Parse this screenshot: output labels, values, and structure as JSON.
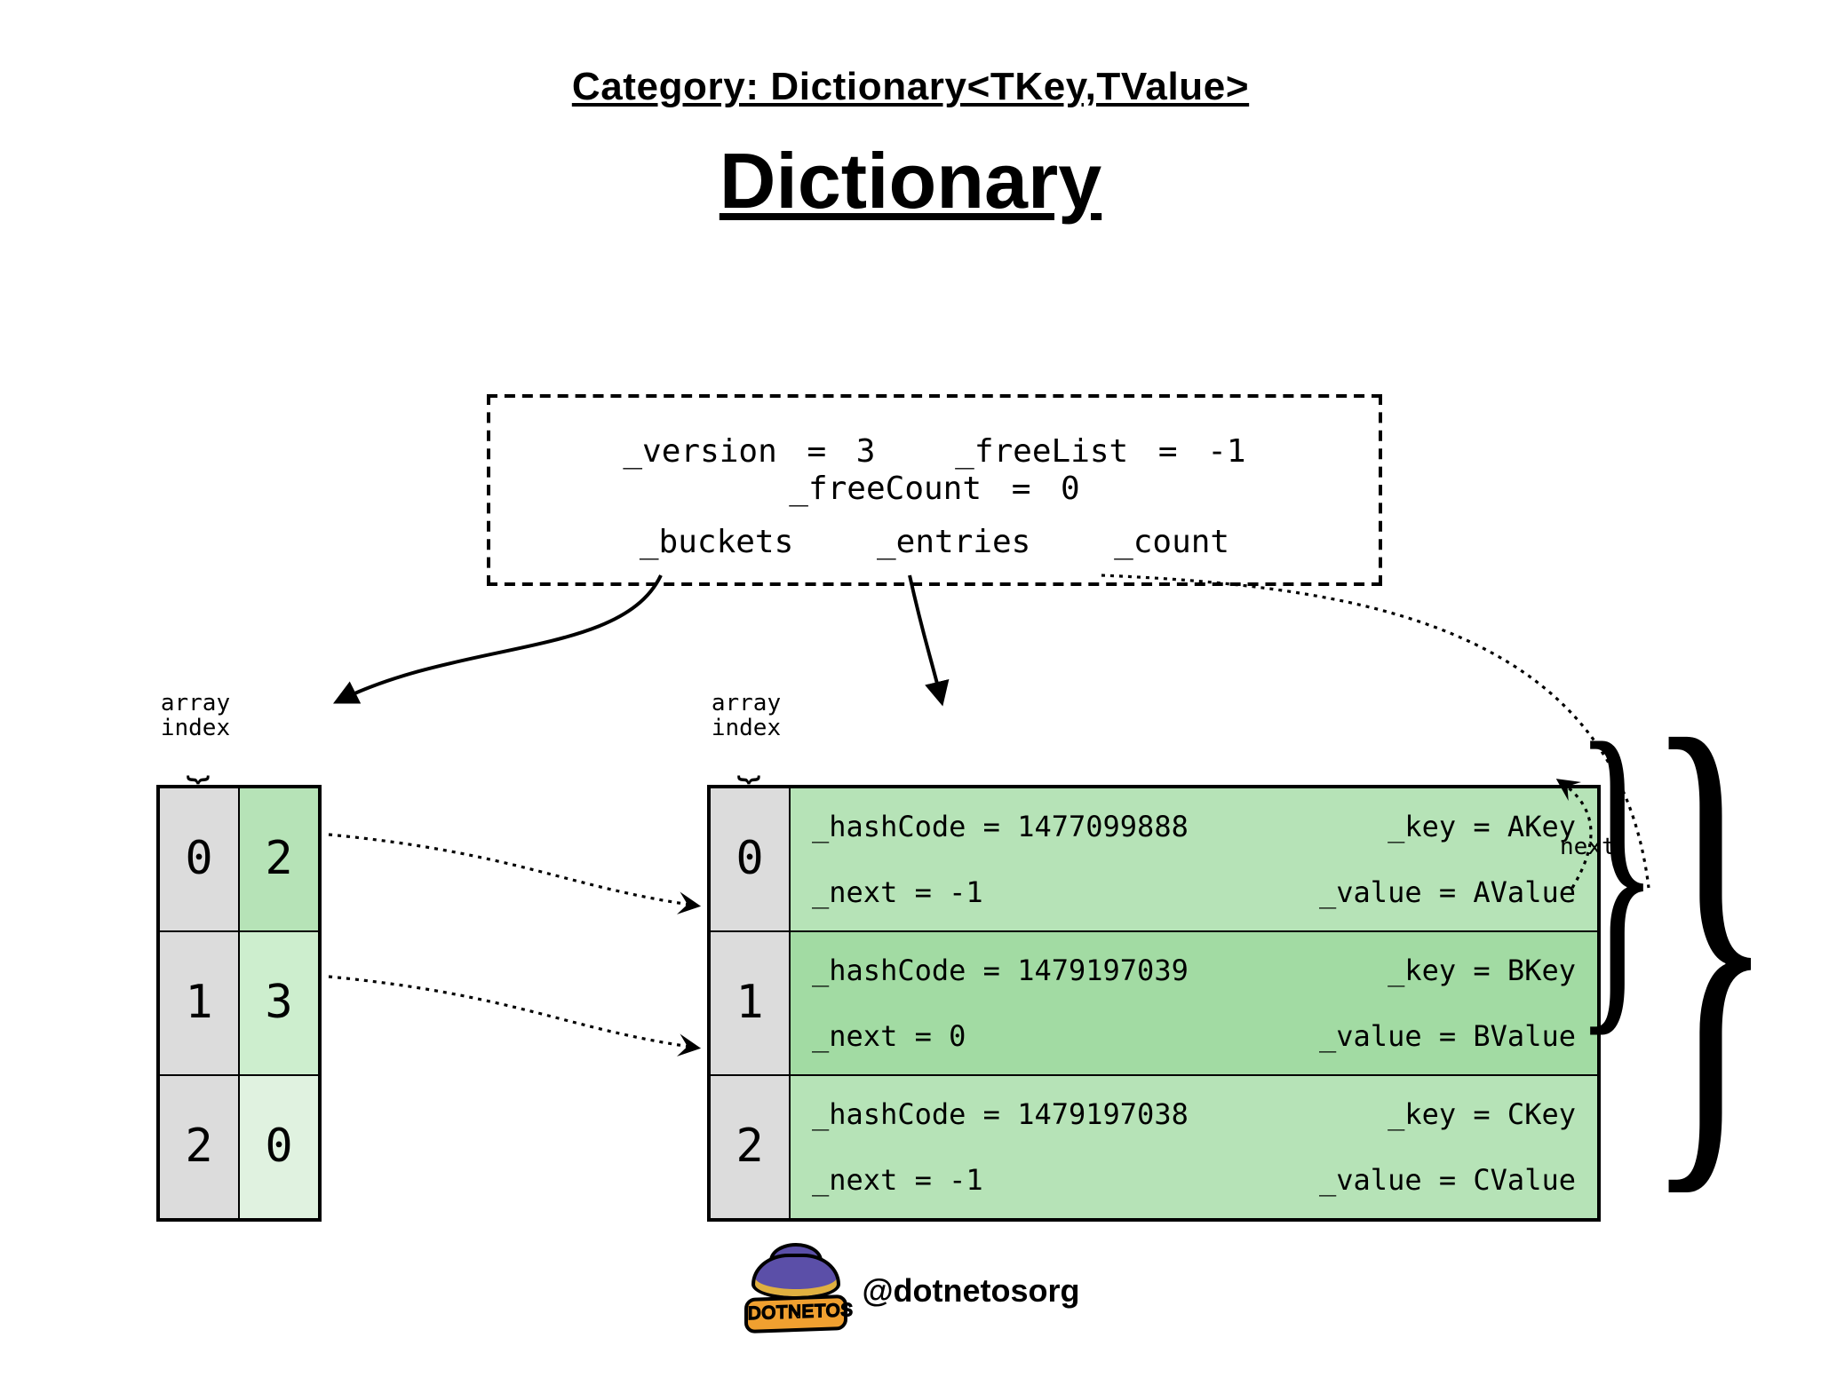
{
  "category_label": "Category: Dictionary<TKey,TValue>",
  "title": "Dictionary",
  "array_index_label": "array\nindex",
  "next_label": "next",
  "handle": "@dotnetosorg",
  "logo_text": "DOTNETOS",
  "meta": {
    "version": "_version = 3",
    "freeList": "_freeList = -1",
    "freeCount": "_freeCount = 0",
    "buckets_label": "_buckets",
    "entries_label": "_entries",
    "count_label": "_count"
  },
  "buckets": [
    {
      "index": "0",
      "value": "2"
    },
    {
      "index": "1",
      "value": "3"
    },
    {
      "index": "2",
      "value": "0"
    }
  ],
  "entries": [
    {
      "index": "0",
      "hashCode": "_hashCode = 1477099888",
      "next": "_next = -1",
      "key": "_key = AKey",
      "value": "_value = AValue"
    },
    {
      "index": "1",
      "hashCode": "_hashCode = 1479197039",
      "next": "_next = 0",
      "key": "_key = BKey",
      "value": "_value = BValue"
    },
    {
      "index": "2",
      "hashCode": "_hashCode = 1479197038",
      "next": "_next = -1",
      "key": "_key = CKey",
      "value": "_value = CValue"
    }
  ]
}
